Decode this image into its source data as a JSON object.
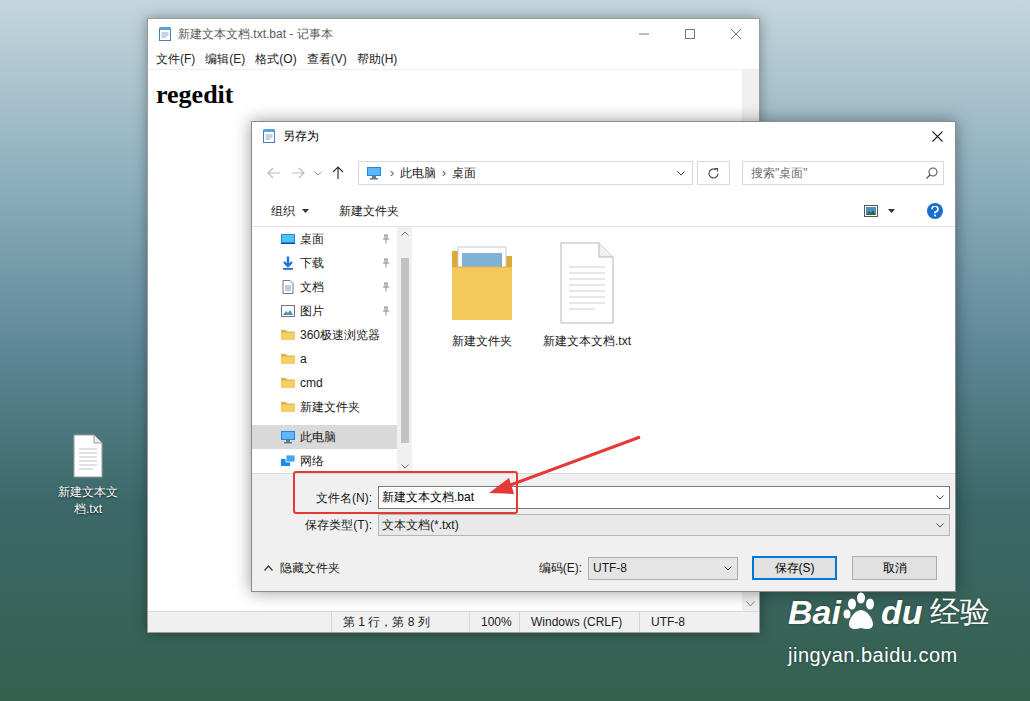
{
  "desktop": {
    "icons": [
      {
        "label": "新建文本文档.txt"
      }
    ]
  },
  "notepad": {
    "title": "新建文本文档.txt.bat - 记事本",
    "menu": [
      "文件(F)",
      "编辑(E)",
      "格式(O)",
      "查看(V)",
      "帮助(H)"
    ],
    "content": "regedit",
    "status_bar": [
      "第 1 行，第 8 列",
      "100%",
      "Windows (CRLF)",
      "UTF-8"
    ]
  },
  "dialog": {
    "title": "另存为",
    "breadcrumb": {
      "separator": "›",
      "items": [
        "此电脑",
        "桌面"
      ]
    },
    "search": {
      "placeholder": "搜索\"桌面\""
    },
    "toolbar": {
      "organize": "组织",
      "new_folder": "新建文件夹"
    },
    "sidebar": {
      "items": [
        {
          "label": "桌面",
          "kind": "desktop",
          "pinned": true,
          "selected": false
        },
        {
          "label": "下载",
          "kind": "download",
          "pinned": true,
          "selected": false
        },
        {
          "label": "文档",
          "kind": "document",
          "pinned": true,
          "selected": false
        },
        {
          "label": "图片",
          "kind": "picture",
          "pinned": true,
          "selected": false
        },
        {
          "label": "360极速浏览器",
          "kind": "folder",
          "pinned": false,
          "selected": false
        },
        {
          "label": "a",
          "kind": "folder",
          "pinned": false,
          "selected": false
        },
        {
          "label": "cmd",
          "kind": "folder",
          "pinned": false,
          "selected": false
        },
        {
          "label": "新建文件夹",
          "kind": "folder",
          "pinned": false,
          "selected": false
        },
        {
          "label": "此电脑",
          "kind": "pc",
          "pinned": false,
          "selected": true
        },
        {
          "label": "网络",
          "kind": "network",
          "pinned": false,
          "selected": false
        }
      ]
    },
    "files": [
      {
        "label": "新建文件夹",
        "kind": "folder"
      },
      {
        "label": "新建文本文档.txt",
        "kind": "text"
      }
    ],
    "filename": {
      "label": "文件名(N):",
      "value": "新建文本文档.bat"
    },
    "filetype": {
      "label": "保存类型(T):",
      "value": "文本文档(*.txt)"
    },
    "hide_folders": "隐藏文件夹",
    "encoding": {
      "label": "编码(E):",
      "value": "UTF-8"
    },
    "buttons": [
      {
        "label": "保存(S)",
        "default": true
      },
      {
        "label": "取消",
        "default": false
      }
    ]
  },
  "watermark": {
    "brand_left": "Bai",
    "brand_right": "du",
    "product": "经验",
    "url": "jingyan.baidu.com"
  }
}
